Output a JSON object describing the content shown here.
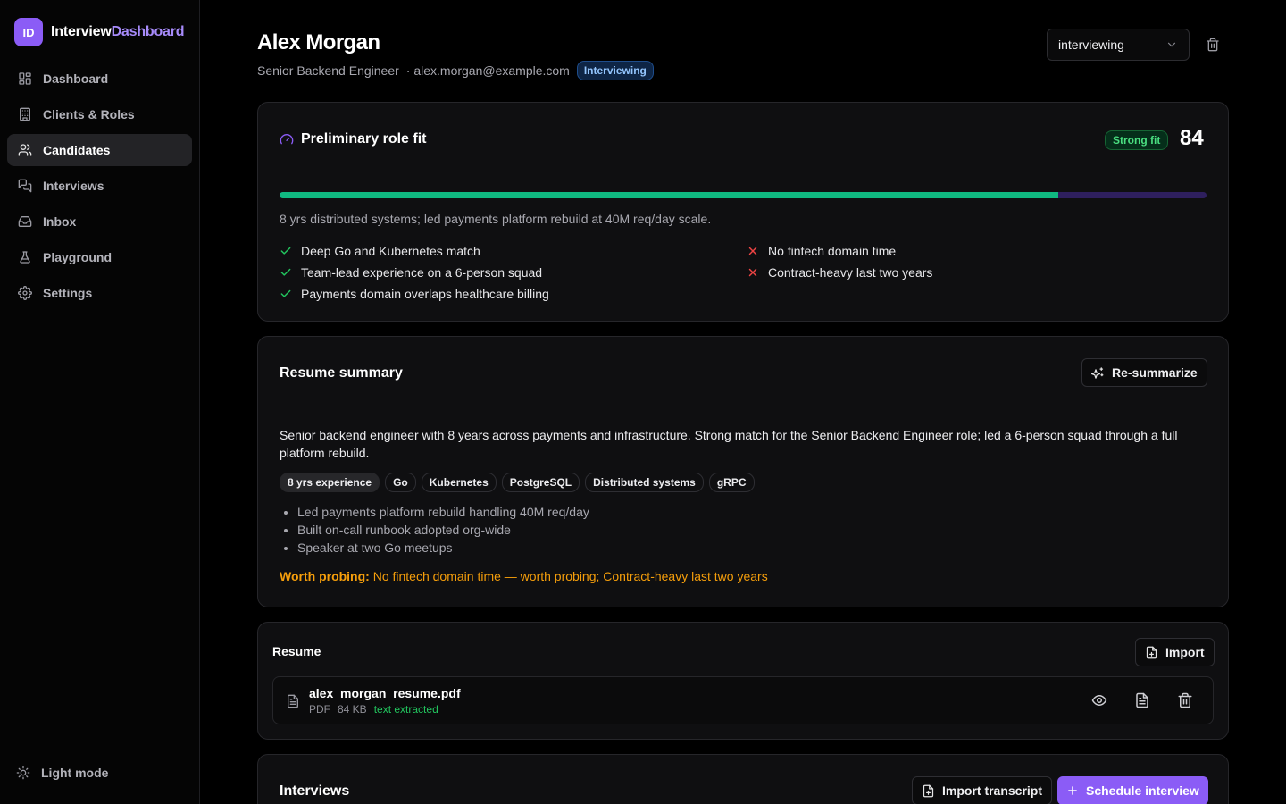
{
  "brand": {
    "logo": "ID",
    "name_part1": "Interview",
    "name_part2": "Dashboard"
  },
  "nav": [
    {
      "label": "Dashboard",
      "icon": "dashboard-icon"
    },
    {
      "label": "Clients & Roles",
      "icon": "building-icon"
    },
    {
      "label": "Candidates",
      "icon": "users-icon",
      "active": true
    },
    {
      "label": "Interviews",
      "icon": "chat-icon"
    },
    {
      "label": "Inbox",
      "icon": "inbox-icon"
    },
    {
      "label": "Playground",
      "icon": "flask-icon"
    },
    {
      "label": "Settings",
      "icon": "gear-icon"
    }
  ],
  "light_mode": "Light mode",
  "candidate": {
    "name": "Alex Morgan",
    "role": "Senior Backend Engineer",
    "email": "· alex.morgan@example.com",
    "status_badge": "Interviewing",
    "status_select": "interviewing"
  },
  "fit": {
    "title": "Preliminary role fit",
    "label": "Strong fit",
    "score": "84",
    "progress_pct": 84,
    "description": "8 yrs distributed systems; led payments platform rebuild at 40M req/day scale.",
    "pros": [
      "Deep Go and Kubernetes match",
      "Team-lead experience on a 6-person squad",
      "Payments domain overlaps healthcare billing"
    ],
    "cons": [
      "No fintech domain time",
      "Contract-heavy last two years"
    ]
  },
  "summary": {
    "title": "Resume summary",
    "resummarize": "Re-summarize",
    "text": "Senior backend engineer with 8 years across payments and infrastructure. Strong match for the Senior Backend Engineer role; led a 6-person squad through a full platform rebuild.",
    "tags": [
      "8 yrs experience",
      "Go",
      "Kubernetes",
      "PostgreSQL",
      "Distributed systems",
      "gRPC"
    ],
    "bullets": [
      "Led payments platform rebuild handling 40M req/day",
      "Built on-call runbook adopted org-wide",
      "Speaker at two Go meetups"
    ],
    "worth_label": "Worth probing:",
    "worth_text": "No fintech domain time — worth probing; Contract-heavy last two years"
  },
  "resume": {
    "title": "Resume",
    "import": "Import",
    "file_name": "alex_morgan_resume.pdf",
    "file_type": "PDF",
    "file_size": "84 KB",
    "file_status": "text extracted"
  },
  "interviews": {
    "title": "Interviews",
    "import_transcript": "Import transcript",
    "schedule": "Schedule interview"
  },
  "colors": {
    "accent": "#8b5cf6",
    "success": "#10b981",
    "danger": "#ef4444",
    "warning": "#f59e0b"
  }
}
